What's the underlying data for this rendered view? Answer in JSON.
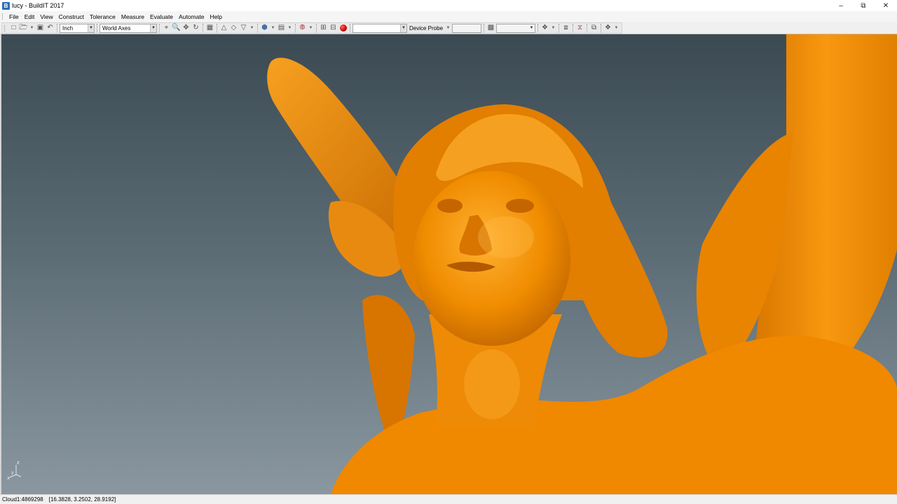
{
  "window": {
    "title": "lucy - BuildIT 2017",
    "app_icon_letter": "B",
    "minimize": "–",
    "restore": "⧉",
    "close": "✕"
  },
  "menu": [
    "File",
    "Edit",
    "View",
    "Construct",
    "Tolerance",
    "Measure",
    "Evaluate",
    "Automate",
    "Help"
  ],
  "toolbar": {
    "units_value": "Inch",
    "coord_system_value": "World Axes",
    "device_field_value": "",
    "device_label": "Device Probe",
    "probe_field_value": "",
    "last_field_value": ""
  },
  "viewport": {
    "background_top": "#3b4a52",
    "background_bottom": "#8a97a0",
    "model_color": "#f08c00",
    "triad_z": "z",
    "triad_x": "x",
    "triad_y": "y"
  },
  "status": {
    "cloud": "Cloud1:4869298",
    "coordinates": "[16.3828, 3.2502, 28.9192]"
  }
}
